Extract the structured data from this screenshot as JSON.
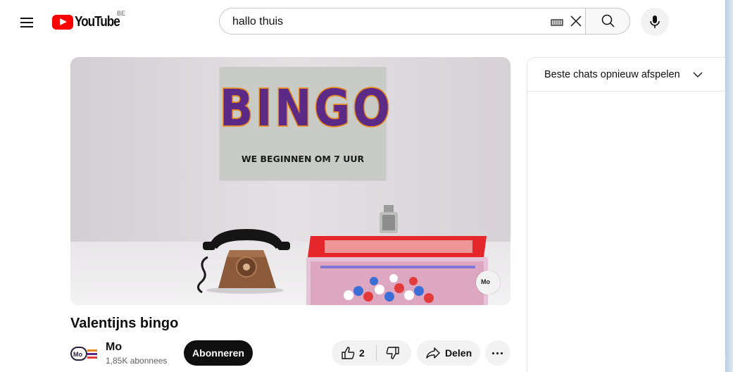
{
  "header": {
    "logo_text": "YouTube",
    "country_code": "BE",
    "search": {
      "value": "hallo thuis"
    }
  },
  "video": {
    "poster_title": "BINGO",
    "poster_subtitle": "WE BEGINNEN OM 7 UUR",
    "title": "Valentijns bingo",
    "watermark_text": "Mo"
  },
  "channel": {
    "avatar_text": "Mo",
    "name": "Mo",
    "subscribers": "1,85K abonnees",
    "subscribe_label": "Abonneren"
  },
  "actions": {
    "like_count": "2",
    "share_label": "Delen"
  },
  "chat": {
    "header_label": "Beste chats opnieuw afspelen"
  },
  "colors": {
    "youtube_red": "#ff0000",
    "subscribe_bg": "#0f0f0f",
    "button_bg": "#f2f2f2",
    "poster_purple": "#5b2a86",
    "poster_orange": "#e8891d"
  },
  "icons": [
    "menu-icon",
    "youtube-play-icon",
    "keyboard-icon",
    "clear-icon",
    "search-icon",
    "mic-icon",
    "like-icon",
    "dislike-icon",
    "share-icon",
    "more-icon",
    "chevron-down-icon"
  ]
}
